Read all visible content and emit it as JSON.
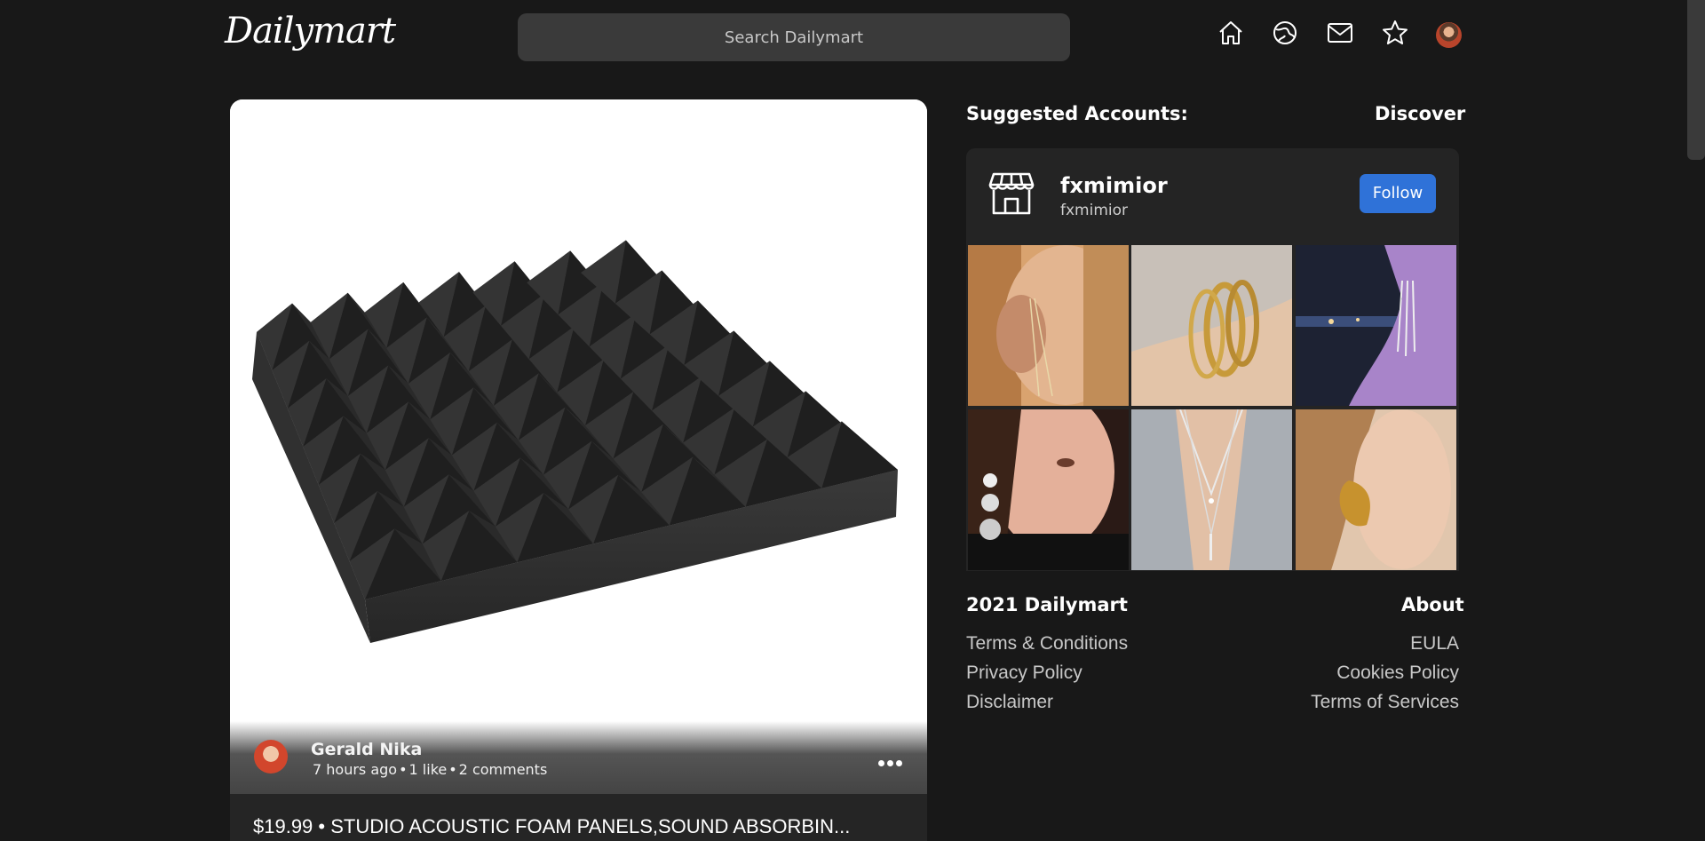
{
  "header": {
    "logo": "Dailymart",
    "search_placeholder": "Search Dailymart",
    "nav_icons": [
      "home-icon",
      "explore-icon",
      "mail-icon",
      "star-icon",
      "profile-avatar"
    ]
  },
  "post": {
    "author": "Gerald Nika",
    "time": "7 hours ago",
    "likes": "1 like",
    "comments": "2 comments",
    "title": "$19.99 • STUDIO ACOUSTIC FOAM PANELS,SOUND ABSORBIN..."
  },
  "sidebar": {
    "suggested_heading": "Suggested Accounts:",
    "discover_link": "Discover",
    "account": {
      "name": "fxmimior",
      "handle": "fxmimior",
      "follow_label": "Follow"
    },
    "footer": {
      "copyright": "2021 Dailymart",
      "about": "About",
      "left_links": [
        "Terms & Conditions",
        "Privacy Policy",
        "Disclaimer"
      ],
      "right_links": [
        "EULA",
        "Cookies Policy",
        "Terms of Services"
      ]
    }
  },
  "colors": {
    "background": "#181818",
    "card": "#242424",
    "search": "#3a3a3a",
    "follow": "#2f72d8"
  }
}
